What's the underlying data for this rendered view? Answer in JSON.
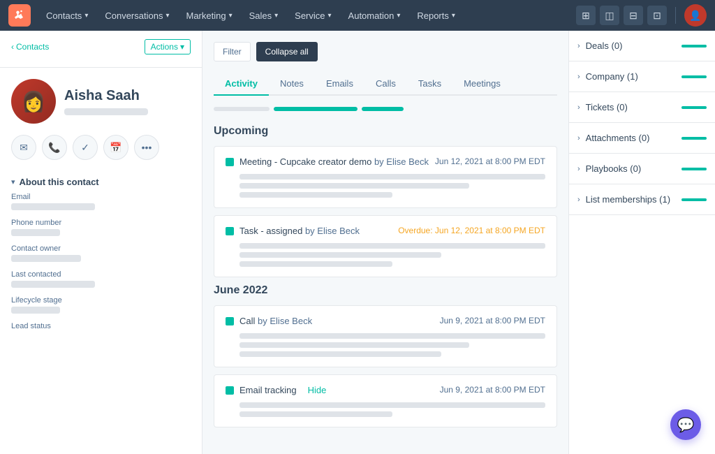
{
  "nav": {
    "items": [
      {
        "label": "Contacts",
        "id": "contacts"
      },
      {
        "label": "Conversations",
        "id": "conversations"
      },
      {
        "label": "Marketing",
        "id": "marketing"
      },
      {
        "label": "Sales",
        "id": "sales"
      },
      {
        "label": "Service",
        "id": "service"
      },
      {
        "label": "Automation",
        "id": "automation"
      },
      {
        "label": "Reports",
        "id": "reports"
      }
    ]
  },
  "breadcrumb": {
    "back_label": "Contacts",
    "actions_label": "Actions"
  },
  "contact": {
    "name": "Aisha Saah",
    "email_label": "Email",
    "phone_label": "Phone number",
    "owner_label": "Contact owner",
    "last_contacted_label": "Last contacted",
    "lifecycle_label": "Lifecycle stage",
    "lead_label": "Lead status",
    "about_label": "About this contact"
  },
  "tabs": {
    "items": [
      {
        "label": "Activity",
        "active": true
      },
      {
        "label": "Notes"
      },
      {
        "label": "Emails"
      },
      {
        "label": "Calls"
      },
      {
        "label": "Tasks"
      },
      {
        "label": "Meetings"
      }
    ]
  },
  "sections": {
    "upcoming": "Upcoming",
    "june2022": "June 2022"
  },
  "activities": [
    {
      "id": "meeting1",
      "type": "meeting",
      "title": "Meeting - Cupcake creator demo",
      "by": "by Elise Beck",
      "date": "Jun 12, 2021 at 8:00 PM EDT",
      "overdue": false
    },
    {
      "id": "task1",
      "type": "task",
      "title": "Task - assigned",
      "by": "by Elise Beck",
      "date": "Overdue: Jun 12, 2021 at 8:00 PM EDT",
      "overdue": true
    },
    {
      "id": "call1",
      "type": "call",
      "title": "Call",
      "by": "by Elise Beck",
      "date": "Jun 9, 2021 at 8:00 PM EDT",
      "overdue": false
    },
    {
      "id": "email1",
      "type": "email",
      "title": "Email tracking",
      "by": "",
      "date": "Jun 9, 2021 at 8:00 PM EDT",
      "overdue": false,
      "hide_label": "Hide"
    }
  ],
  "right_panel": {
    "sections": [
      {
        "id": "deals",
        "label": "Deals (0)"
      },
      {
        "id": "company",
        "label": "Company (1)"
      },
      {
        "id": "tickets",
        "label": "Tickets (0)"
      },
      {
        "id": "attachments",
        "label": "Attachments (0)"
      },
      {
        "id": "playbooks",
        "label": "Playbooks (0)"
      },
      {
        "id": "list_memberships",
        "label": "List memberships (1)"
      }
    ]
  },
  "filter": {
    "btn1": "Filter",
    "btn2": "Collapse all"
  }
}
